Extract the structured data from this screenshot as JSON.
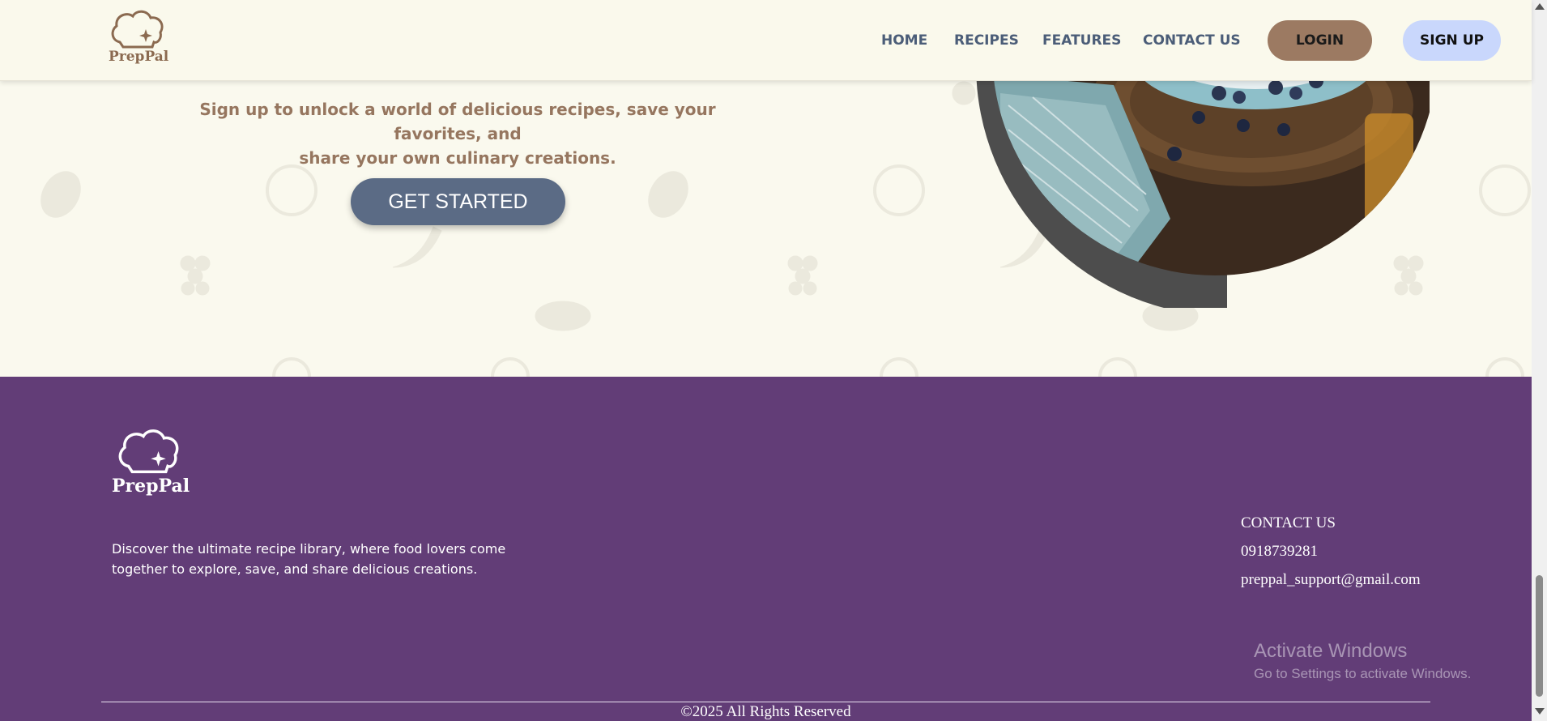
{
  "header": {
    "brand": "PrepPal",
    "nav": [
      {
        "label": "HOME"
      },
      {
        "label": "RECIPES"
      },
      {
        "label": "FEATURES"
      },
      {
        "label": "CONTACT US"
      }
    ],
    "login_label": "LOGIN",
    "signup_label": "SIGN UP"
  },
  "hero": {
    "subtitle_line1": "Sign up to unlock a world of delicious recipes, save your favorites, and",
    "subtitle_line2": "share your own culinary creations.",
    "cta_label": "GET STARTED",
    "image_icon": "pancakes-photo"
  },
  "footer": {
    "brand": "PrepPal",
    "description_line1": "Discover the ultimate recipe library, where food lovers come",
    "description_line2": "together to explore, save, and share delicious creations.",
    "contact_title": "CONTACT US",
    "phone": "0918739281",
    "email": "preppal_support@gmail.com",
    "copyright": "©2025 All Rights Reserved"
  },
  "watermark": {
    "title": "Activate Windows",
    "subtitle": "Go to Settings to activate Windows."
  },
  "colors": {
    "background": "#faf9ee",
    "brown": "#9c7a62",
    "nav_text": "#4b5d78",
    "signup_bg": "#c9d7fc",
    "cta_bg": "#5b6b85",
    "footer_bg": "#623d77"
  }
}
